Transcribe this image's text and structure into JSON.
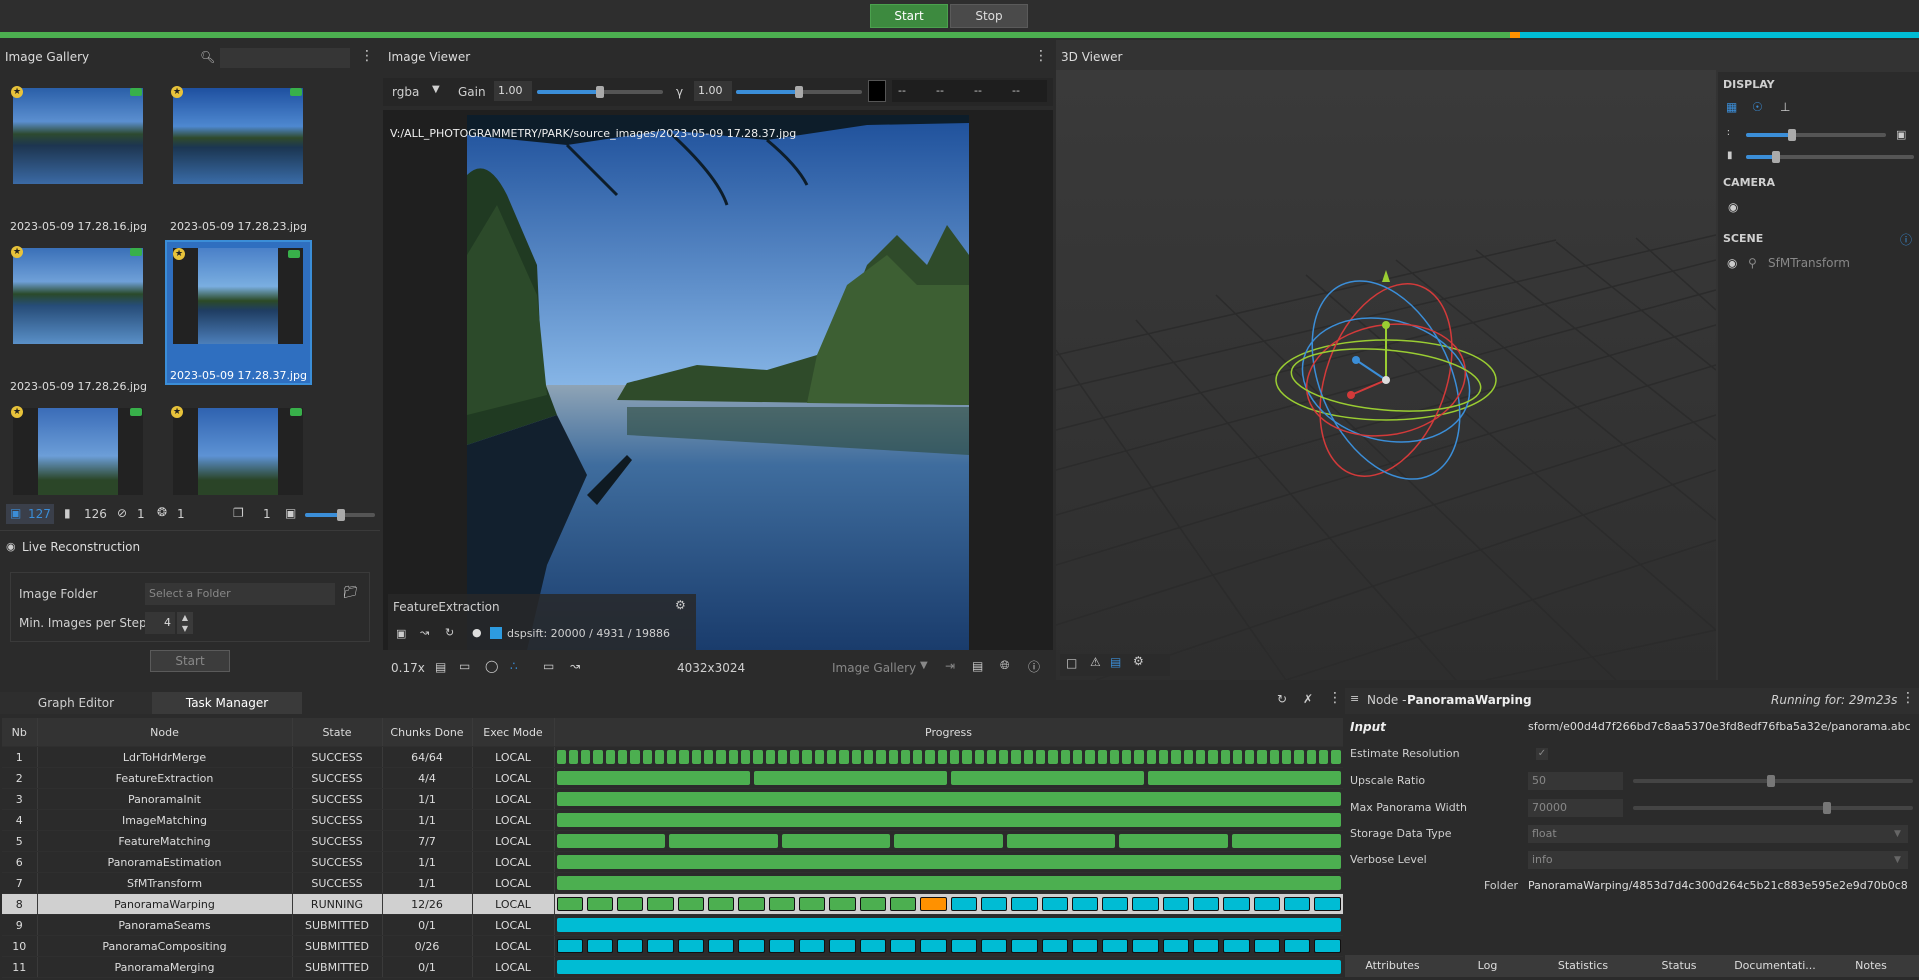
{
  "topbar": {
    "start_label": "Start",
    "stop_label": "Stop"
  },
  "gallery": {
    "title": "Image Gallery",
    "thumbnails": [
      {
        "label": "2023-05-09 17.28.16.jpg"
      },
      {
        "label": "2023-05-09 17.28.23.jpg"
      },
      {
        "label": "2023-05-09 17.28.26.jpg"
      },
      {
        "label": "2023-05-09 17.28.37.jpg"
      },
      {
        "label": ""
      },
      {
        "label": ""
      }
    ],
    "footer": {
      "images": "127",
      "cameras": "126",
      "rejected": "1",
      "intrinsics": "1",
      "groups": "1"
    }
  },
  "live": {
    "title": "Live Reconstruction",
    "folder_label": "Image Folder",
    "folder_placeholder": "Select a Folder",
    "min_label": "Min. Images per Step",
    "min_value": "4",
    "start_label": "Start"
  },
  "viewer": {
    "title": "Image Viewer",
    "channel": "rgba",
    "gain_label": "Gain",
    "gain_value": "1.00",
    "gamma_label": "γ",
    "gamma_value": "1.00",
    "rgba_values": [
      "--",
      "--",
      "--",
      "--"
    ],
    "path": "V:/ALL_PHOTOGRAMMETRY/PARK/source_images/2023-05-09 17.28.37.jpg",
    "fe_title": "FeatureExtraction",
    "fe_stats": "dspsift: 20000 / 4931 / 19886",
    "zoom": "0.17x",
    "resolution": "4032x3024",
    "source": "Image Gallery"
  },
  "viewer3d": {
    "title": "3D Viewer",
    "display_label": "DISPLAY",
    "camera_label": "CAMERA",
    "scene_label": "SCENE",
    "scene_item": "SfMTransform"
  },
  "tabs": {
    "graph_editor": "Graph Editor",
    "task_manager": "Task Manager"
  },
  "task_table": {
    "headers": [
      "Nb",
      "Node",
      "State",
      "Chunks Done",
      "Exec Mode",
      "Progress"
    ],
    "rows": [
      {
        "nb": "1",
        "node": "LdrToHdrMerge",
        "state": "SUCCESS",
        "chunks": "64/64",
        "mode": "LOCAL",
        "done": 64,
        "total": 64,
        "status": "success"
      },
      {
        "nb": "2",
        "node": "FeatureExtraction",
        "state": "SUCCESS",
        "chunks": "4/4",
        "mode": "LOCAL",
        "done": 4,
        "total": 4,
        "status": "success"
      },
      {
        "nb": "3",
        "node": "PanoramaInit",
        "state": "SUCCESS",
        "chunks": "1/1",
        "mode": "LOCAL",
        "done": 1,
        "total": 1,
        "status": "success"
      },
      {
        "nb": "4",
        "node": "ImageMatching",
        "state": "SUCCESS",
        "chunks": "1/1",
        "mode": "LOCAL",
        "done": 1,
        "total": 1,
        "status": "success"
      },
      {
        "nb": "5",
        "node": "FeatureMatching",
        "state": "SUCCESS",
        "chunks": "7/7",
        "mode": "LOCAL",
        "done": 7,
        "total": 7,
        "status": "success"
      },
      {
        "nb": "6",
        "node": "PanoramaEstimation",
        "state": "SUCCESS",
        "chunks": "1/1",
        "mode": "LOCAL",
        "done": 1,
        "total": 1,
        "status": "success"
      },
      {
        "nb": "7",
        "node": "SfMTransform",
        "state": "SUCCESS",
        "chunks": "1/1",
        "mode": "LOCAL",
        "done": 1,
        "total": 1,
        "status": "success"
      },
      {
        "nb": "8",
        "node": "PanoramaWarping",
        "state": "RUNNING",
        "chunks": "12/26",
        "mode": "LOCAL",
        "done": 12,
        "total": 26,
        "status": "running"
      },
      {
        "nb": "9",
        "node": "PanoramaSeams",
        "state": "SUBMITTED",
        "chunks": "0/1",
        "mode": "LOCAL",
        "done": 0,
        "total": 1,
        "status": "submitted"
      },
      {
        "nb": "10",
        "node": "PanoramaCompositing",
        "state": "SUBMITTED",
        "chunks": "0/26",
        "mode": "LOCAL",
        "done": 0,
        "total": 26,
        "status": "submitted"
      },
      {
        "nb": "11",
        "node": "PanoramaMerging",
        "state": "SUBMITTED",
        "chunks": "0/1",
        "mode": "LOCAL",
        "done": 0,
        "total": 1,
        "status": "submitted"
      }
    ]
  },
  "node_panel": {
    "prefix": "Node - ",
    "name": "PanoramaWarping",
    "running_for": "Running for: 29m23s",
    "input_label": "Input",
    "input_value": "sform/e00d4d7f266bd7c8aa5370e3fd8edf76fba5a32e/panorama.abc",
    "estimate_label": "Estimate Resolution",
    "upscale_label": "Upscale Ratio",
    "upscale_value": "50",
    "upscale_level": 0.5,
    "maxwidth_label": "Max Panorama Width",
    "maxwidth_value": "70000",
    "maxwidth_level": 0.7,
    "storage_label": "Storage Data Type",
    "storage_value": "float",
    "verbose_label": "Verbose Level",
    "verbose_value": "info",
    "folder_label": "Folder",
    "folder_value": "PanoramaWarping/4853d7d4c300d264c5b21c883e595e2e9d70b0c8",
    "tabs": [
      "Attributes",
      "Log",
      "Statistics",
      "Status",
      "Documentati...",
      "Notes"
    ]
  },
  "colors": {
    "success": "#4caf50",
    "running": "#ff9100",
    "submitted": "#00bcd4",
    "accent": "#3b8ed8"
  }
}
